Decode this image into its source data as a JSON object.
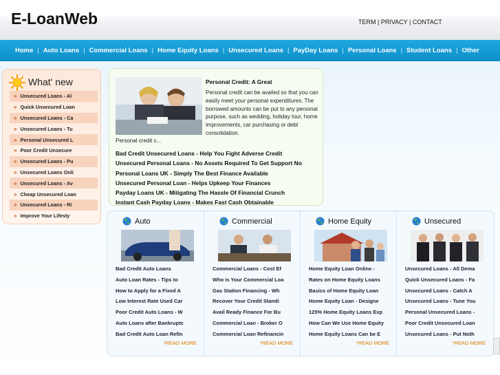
{
  "site": {
    "logo": "E-LoanWeb"
  },
  "top_links": {
    "term": "TERM",
    "sep1": " | ",
    "privacy": "PRIVACY",
    "sep2": " | ",
    "contact": "CONTACT"
  },
  "nav": [
    "Home",
    "Auto Loans",
    "Commercial Loans",
    "Home Equity Loans",
    "Unsecured Loans",
    "PayDay Loans",
    "Personal Loans",
    "Student Loans",
    "Other"
  ],
  "nav_separator": "|",
  "sidebar": {
    "title": "What' new",
    "arrow": "»",
    "items": [
      "Unsecured Loans - Al",
      "Quick Unsecured Loan",
      "Unsecured Loans - Ca",
      "Unsecured Loans - Tu",
      "Personal Unsecured L",
      "Poor Credit Unsecure",
      "Unsecured Loans - Pu",
      "Unsecured Loans Onli",
      "Unsecured Loans - Av",
      "Cheap Unsecured Loan",
      "Unsecured Loans - Ri",
      "Improve Your Lifesty"
    ]
  },
  "featured": {
    "title": "Personal Credit: A Great",
    "body": "Personal credit can be availed so that you can easily meet your personal expenditures. The borrowed amounts can be put to any personal purpose, such as wedding, holiday tour, home improvements, car purchasing or debt consolidation.",
    "more": "Personal credit c...",
    "links": [
      "Bad Credit Unsecured Loans - Help You Fight Adverse Credit",
      "Unsecured Personal Loans - No Assets Required To Get Support No",
      "Personal Loans UK - Simply The Best Finance Available",
      "Unsecured Personal Loan - Helps Upkeep Your Finances",
      "Payday Loans UK - Mitigating The Hassle Of Financial Crunch",
      "Instant Cash Payday Loans - Makes Fast Cash Obtainable"
    ]
  },
  "categories": [
    {
      "title": "Auto",
      "readmore": "*READ MORE",
      "links": [
        "Bad Credit Auto Loans",
        "Auto Loan Rates - Tips to",
        "How to Apply for a Fixed A",
        "Low Interest Rate Used Car",
        "Poor Credit Auto Loans - W",
        "Auto Loans after Bankruptc",
        "Bad Credit Auto Loan Refin"
      ]
    },
    {
      "title": "Commercial",
      "readmore": "*READ MORE",
      "links": [
        "Commercial Loans - Cost Ef",
        "Who is Your Commercial Loa",
        "Gas Station Financing - Wh",
        "Recover Your Credit Standi",
        "Avail Ready Finance For Bu",
        "Commercial Loan - Broker O",
        "Commercial Loan Refinancin"
      ]
    },
    {
      "title": "Home Equity",
      "readmore": "*READ MORE",
      "links": [
        "Home Equity Loan Online -",
        "Rates on Home Equity Loans",
        "Basics of Home Equity Loan",
        "Home Equity Loan - Designe",
        "125% Home Equity Loans Exp",
        "How Can We Use Home Equity",
        "Home Equity Loans Can be E"
      ]
    },
    {
      "title": "Unsecured",
      "readmore": "*READ MORE",
      "links": [
        "Unsecured Loans - All Dema",
        "Quick Unsecured Loans - Fa",
        "Unsecured Loans - Catch A",
        "Unsecured Loans - Tune You",
        "Personal Unsecured Loans -",
        "Poor Credit Unsecured Loan",
        "Unsecured Loans - Put Noth"
      ]
    }
  ],
  "colors": {
    "nav_bg": "#159bd6",
    "readmore": "#e07a00",
    "sidebar_bg": "#fde9dc",
    "featured_bg": "#f7fcf2"
  }
}
